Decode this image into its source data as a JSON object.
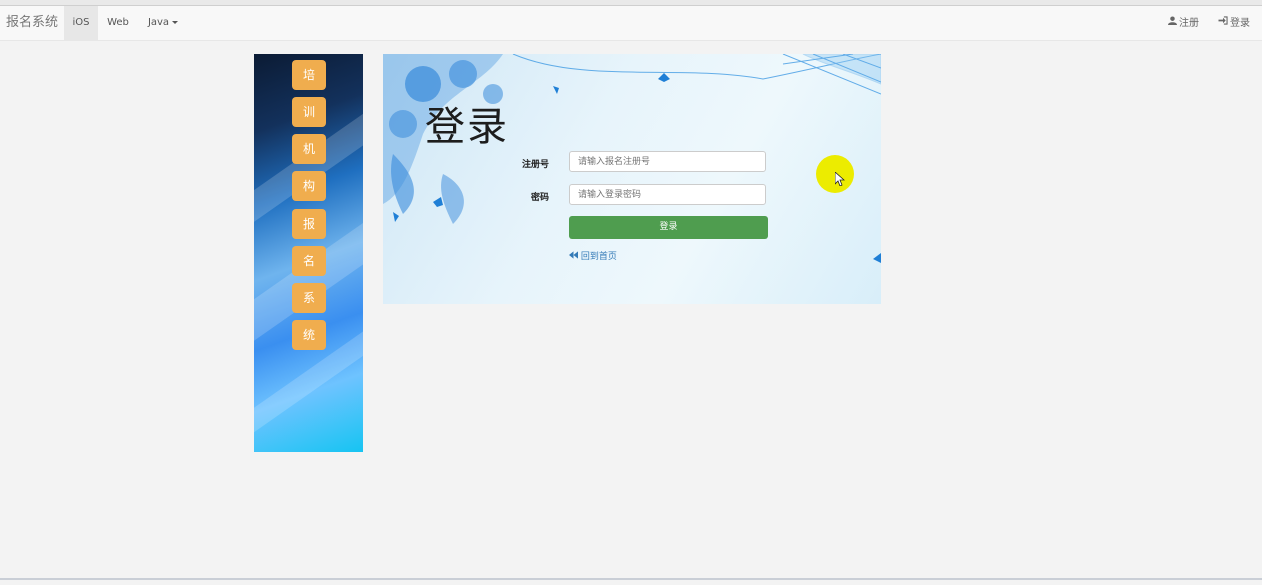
{
  "navbar": {
    "brand": "报名系统",
    "items": [
      {
        "label": "iOS",
        "active": true
      },
      {
        "label": "Web"
      },
      {
        "label": "Java",
        "dropdown": true
      }
    ],
    "right": {
      "register_label": "注册",
      "login_label": "登录"
    }
  },
  "side_banner": {
    "chars": [
      "培",
      "训",
      "机",
      "构",
      "报",
      "名",
      "系",
      "统"
    ],
    "tile_color": "#f0ad4e"
  },
  "login": {
    "title": "登录",
    "register_label": "注册号",
    "register_placeholder": "请输入报名注册号",
    "password_label": "密码",
    "password_placeholder": "请输入登录密码",
    "submit_label": "登录",
    "back_link": "回到首页",
    "submit_color": "#4f9d4f",
    "link_color": "#337ab7"
  }
}
